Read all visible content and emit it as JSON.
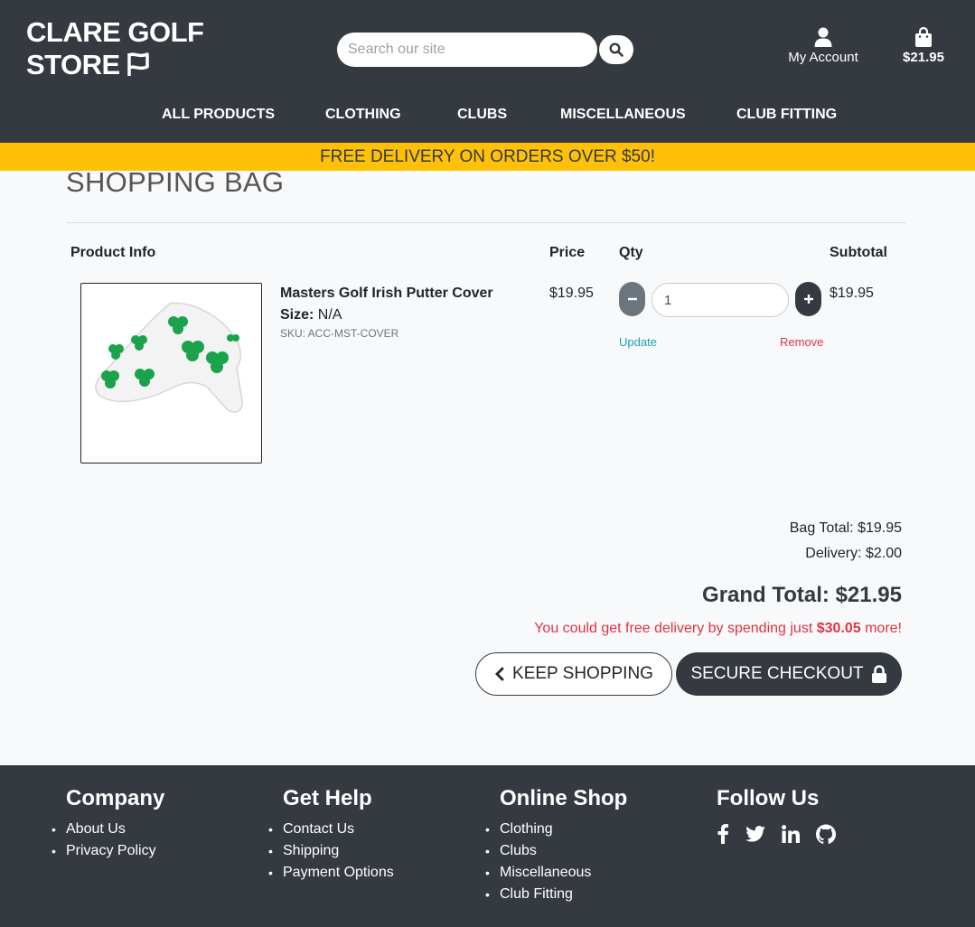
{
  "header": {
    "logo_line1": "CLARE GOLF",
    "logo_line2": "STORE",
    "search_placeholder": "Search our site",
    "account_label": "My Account",
    "cart_total": "$21.95"
  },
  "nav": [
    {
      "label": "ALL PRODUCTS"
    },
    {
      "label": "CLOTHING"
    },
    {
      "label": "CLUBS"
    },
    {
      "label": "MISCELLANEOUS"
    },
    {
      "label": "CLUB FITTING"
    }
  ],
  "banner": "FREE DELIVERY ON ORDERS OVER $50!",
  "bag": {
    "title": "SHOPPING BAG",
    "headers": {
      "product": "Product Info",
      "price": "Price",
      "qty": "Qty",
      "subtotal": "Subtotal"
    },
    "items": [
      {
        "name": "Masters Golf Irish Putter Cover",
        "size_label": "Size:",
        "size_value": " N/A",
        "sku": "SKU: ACC-MST-COVER",
        "price": "$19.95",
        "qty": "1",
        "subtotal": "$19.95",
        "update_label": "Update",
        "remove_label": "Remove"
      }
    ],
    "bag_total": "Bag Total: $19.95",
    "delivery": "Delivery: $2.00",
    "grand_total": "Grand Total: $21.95",
    "free_msg_prefix": "You could get free delivery by spending just ",
    "free_msg_amount": "$30.05",
    "free_msg_suffix": " more!",
    "keep_shopping": "KEEP SHOPPING",
    "secure_checkout": "SECURE CHECKOUT"
  },
  "footer": {
    "company": {
      "title": "Company",
      "links": [
        "About Us",
        "Privacy Policy"
      ]
    },
    "help": {
      "title": "Get Help",
      "links": [
        "Contact Us",
        "Shipping",
        "Payment Options"
      ]
    },
    "shop": {
      "title": "Online Shop",
      "links": [
        "Clothing",
        "Clubs",
        "Miscellaneous",
        "Club Fitting"
      ]
    },
    "follow": {
      "title": "Follow Us",
      "icons": [
        "facebook-icon",
        "twitter-icon",
        "linkedin-icon",
        "github-icon"
      ]
    }
  },
  "colors": {
    "dark": "#343a40",
    "banner": "#ffc107",
    "update_link": "#17a2b8",
    "danger": "#dc3545"
  }
}
